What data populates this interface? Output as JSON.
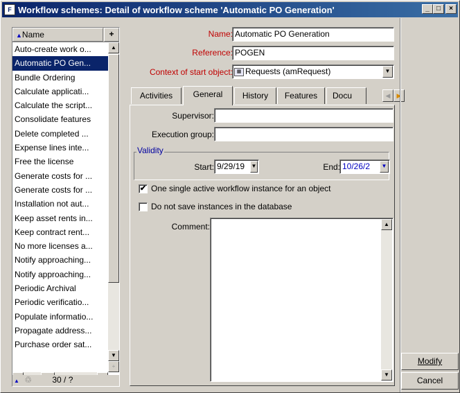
{
  "window": {
    "title": "Workflow schemes: Detail of workflow scheme 'Automatic PO Generation'",
    "icon_label": "F",
    "min_label": "_",
    "max_label": "□",
    "close_label": "×"
  },
  "list": {
    "column_header": "Name",
    "add_label": "+",
    "items": [
      "Auto-create work o...",
      "Automatic PO Gen...",
      "Bundle Ordering",
      "Calculate applicati...",
      "Calculate the script...",
      "Consolidate features",
      "Delete completed ...",
      "Expense lines inte...",
      "Free the license",
      "Generate costs for ...",
      "Generate costs for ...",
      "Installation not aut...",
      "Keep asset rents in...",
      "Keep contract rent...",
      "No more licenses a...",
      "Notify approaching...",
      "Notify approaching...",
      "Periodic Archival",
      "Periodic verificatio...",
      "Populate informatio...",
      "Propagate address...",
      "Purchase order sat..."
    ],
    "selected_index": 1,
    "counter": "30 / ?"
  },
  "form": {
    "name_label": "Name:",
    "name_value": "Automatic PO Generation",
    "reference_label": "Reference:",
    "reference_value": "POGEN",
    "context_label": "Context of start object:",
    "context_value": "Requests (amRequest)"
  },
  "tabs": [
    "Activities",
    "General",
    "History",
    "Features",
    "Docu"
  ],
  "active_tab": "General",
  "general": {
    "supervisor_label": "Supervisor:",
    "supervisor_value": "",
    "exec_group_label": "Execution group:",
    "exec_group_value": "",
    "validity_label": "Validity",
    "start_label": "Start:",
    "start_value": "9/29/19",
    "end_label": "End:",
    "end_value": "10/26/2",
    "chk1_label": "One single active workflow instance for an object",
    "chk1_checked": true,
    "chk2_label": "Do not save instances in the database",
    "chk2_checked": false,
    "comment_label": "Comment:",
    "comment_value": ""
  },
  "buttons": {
    "modify": "Modify",
    "cancel": "Cancel"
  }
}
